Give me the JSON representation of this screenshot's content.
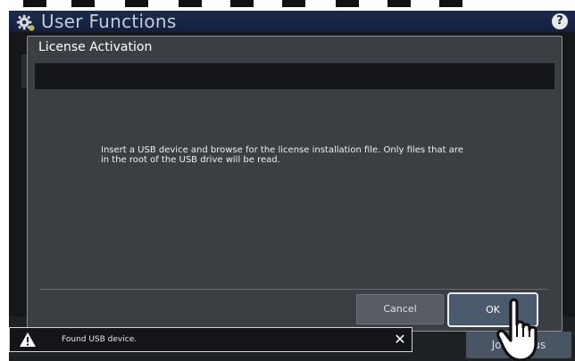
{
  "app": {
    "title": "User Functions",
    "help_label": "?"
  },
  "dialog": {
    "title": "License Activation",
    "message": "Insert a USB device and browse for the license installation file. Only files that are\nin the root of the USB drive will be read.",
    "cancel_label": "Cancel",
    "ok_label": "OK"
  },
  "background": {
    "job_status_label": "Job Status"
  },
  "toast": {
    "message": "Found USB device.",
    "close_label": "✕"
  },
  "icons": {
    "app": "gear-icon",
    "help": "help-icon",
    "toast": "warning-icon",
    "close": "close-icon",
    "pointer": "hand-pointer-icon"
  },
  "colors": {
    "topbar": "#1d2a4a",
    "dialog": "#3b3e42",
    "accent_border": "#e9edf2"
  }
}
